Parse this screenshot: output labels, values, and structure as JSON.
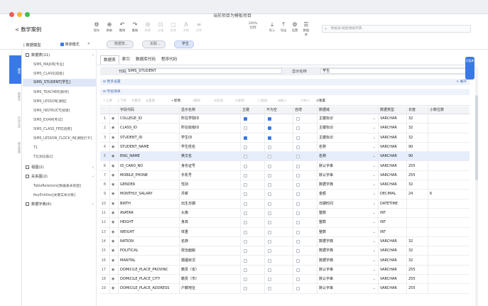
{
  "window": {
    "title": "当前项目为模板项目"
  },
  "app": {
    "title": "数学案例",
    "back": "<"
  },
  "toolbar": {
    "left": [
      {
        "icon": "⚙",
        "label": "保存"
      },
      {
        "icon": "⊕",
        "label": "刷新"
      },
      {
        "icon": "↶",
        "label": "撤销"
      },
      {
        "icon": "↷",
        "label": "重做"
      },
      {
        "icon": "⊞",
        "label": "新建",
        "disabled": true
      },
      {
        "icon": "⊡",
        "label": "分组",
        "disabled": true
      },
      {
        "icon": "▢",
        "label": "形状",
        "disabled": true
      },
      {
        "icon": "A",
        "label": "字体",
        "disabled": true
      },
      {
        "icon": "≡",
        "label": "对齐",
        "disabled": true
      }
    ],
    "zoom": {
      "label": "100%",
      "caption": "比例"
    },
    "right": [
      {
        "icon": "⤓",
        "label": "导入"
      },
      {
        "icon": "⤒",
        "label": "导出"
      },
      {
        "icon": "⚙",
        "label": "设置"
      },
      {
        "icon": "☰",
        "label": "数据库"
      }
    ]
  },
  "search": {
    "placeholder": "数据表/视图/数据字典"
  },
  "model": {
    "label": "| 数据模型",
    "mode": "简单模式",
    "collapse": "«"
  },
  "doctabs": [
    {
      "label": "数据表...",
      "active": false
    },
    {
      "label": "关联...",
      "active": false
    },
    {
      "label": "学生",
      "active": true
    }
  ],
  "sidebar_icons": [
    {
      "label": "模型",
      "active": true
    },
    {
      "label": "数据库",
      "active": false
    },
    {
      "label": "代码生成",
      "active": false
    },
    {
      "label": "版本管理",
      "active": false
    }
  ],
  "tree": {
    "groups": [
      {
        "label": "数据表(11)"
      },
      {
        "label": "视图(2)"
      },
      {
        "label": "关系图(2)"
      },
      {
        "label": "数据字典(6)"
      }
    ],
    "tables": [
      "SIMS_MAJOR[专业]",
      "SIMS_CLASS[班级]",
      "SIMS_STUDENT[学生]",
      "SIMS_TEACHER[教师]",
      "SIMS_LESSON[课程]",
      "SIMS_INSTRUCT[授课]",
      "SIMS_EXAM[考试]",
      "SIMS_CLASS_FEE[班费]",
      "SIMS_LESSON_CLOCK_IN[课程打卡]",
      "T1",
      "T2[测试表2]"
    ],
    "diagrams": [
      "TableRelations[数据表关系图]",
      "KeyEntities[关键实体对象]"
    ]
  },
  "tabs": [
    "数据表",
    "索引",
    "数据库代码",
    "程序代码"
  ],
  "form": {
    "code_label": "代码",
    "code_value": "SIMS_STUDENT",
    "name_label": "显示名称",
    "name_value": "学生"
  },
  "section_more": {
    "label": "⊟ 更多设置",
    "toggle": "∨ 展开"
  },
  "section_fields": {
    "label": "⊟ 字段清单"
  },
  "subtoolbar": [
    "↑上移",
    "↓下移",
    "⇈置顶",
    "⇊置底",
    "+新增",
    "−删除",
    "⊕追加",
    "⊡复制",
    "□粘贴",
    "⊞插入",
    "☷导入",
    "↺重置"
  ],
  "columns": [
    "",
    "",
    "字段代码",
    "显示名称",
    "主键",
    "不为空",
    "自增",
    "数据域",
    "数据类型",
    "长度",
    "小数位数"
  ],
  "rows": [
    {
      "no": "1",
      "code": "COLLEGE_ID",
      "name": "所在学院ID",
      "pk": true,
      "nn": true,
      "ai": false,
      "domain": "主键标识",
      "type": "VARCHAR",
      "len": "32",
      "dec": ""
    },
    {
      "no": "2",
      "code": "CLASS_ID",
      "name": "所在班级ID",
      "pk": false,
      "nn": true,
      "ai": false,
      "domain": "主键标识",
      "type": "VARCHAR",
      "len": "32",
      "dec": ""
    },
    {
      "no": "3",
      "code": "STUDENT_ID",
      "name": "学生ID",
      "pk": true,
      "nn": true,
      "ai": false,
      "domain": "主键标识",
      "type": "VARCHAR",
      "len": "32",
      "dec": ""
    },
    {
      "no": "4",
      "code": "STUDENT_NAME",
      "name": "学生姓名",
      "pk": false,
      "nn": false,
      "ai": false,
      "domain": "名称",
      "type": "VARCHAR",
      "len": "90",
      "dec": ""
    },
    {
      "no": "5",
      "code": "ENG_NAME",
      "name": "英文名",
      "pk": false,
      "nn": false,
      "ai": false,
      "domain": "名称",
      "type": "VARCHAR",
      "len": "90",
      "dec": "",
      "hl": true
    },
    {
      "no": "6",
      "code": "ID_CARD_NO",
      "name": "身份证号",
      "pk": false,
      "nn": false,
      "ai": false,
      "domain": "默认字串",
      "type": "VARCHAR",
      "len": "255",
      "dec": ""
    },
    {
      "no": "7",
      "code": "MOBILE_PHONE",
      "name": "手机号",
      "pk": false,
      "nn": false,
      "ai": false,
      "domain": "默认字串",
      "type": "VARCHAR",
      "len": "255",
      "dec": ""
    },
    {
      "no": "8",
      "code": "GENDER",
      "name": "性别",
      "pk": false,
      "nn": false,
      "ai": false,
      "domain": "数据字典",
      "type": "VARCHAR",
      "len": "32",
      "dec": ""
    },
    {
      "no": "9",
      "code": "MONTHLY_SALARY",
      "name": "月薪",
      "pk": false,
      "nn": false,
      "ai": false,
      "domain": "金额",
      "type": "DECIMAL",
      "len": "24",
      "dec": "6"
    },
    {
      "no": "10",
      "code": "BIRTH",
      "name": "出生日期",
      "pk": false,
      "nn": false,
      "ai": false,
      "domain": "日期时间",
      "type": "DATETIME",
      "len": "",
      "dec": ""
    },
    {
      "no": "11",
      "code": "AVATAR",
      "name": "头像",
      "pk": false,
      "nn": false,
      "ai": false,
      "domain": "整数",
      "type": "INT",
      "len": "",
      "dec": ""
    },
    {
      "no": "12",
      "code": "HEIGHT",
      "name": "身高",
      "pk": false,
      "nn": false,
      "ai": false,
      "domain": "整数",
      "type": "INT",
      "len": "",
      "dec": ""
    },
    {
      "no": "13",
      "code": "WEIGHT",
      "name": "体重",
      "pk": false,
      "nn": false,
      "ai": false,
      "domain": "整数",
      "type": "INT",
      "len": "",
      "dec": ""
    },
    {
      "no": "14",
      "code": "NATION",
      "name": "名族",
      "pk": false,
      "nn": false,
      "ai": false,
      "domain": "数据字典",
      "type": "VARCHAR",
      "len": "32",
      "dec": ""
    },
    {
      "no": "15",
      "code": "POLITICAL",
      "name": "政治面貌",
      "pk": false,
      "nn": false,
      "ai": false,
      "domain": "数据字典",
      "type": "VARCHAR",
      "len": "32",
      "dec": ""
    },
    {
      "no": "16",
      "code": "MARITAL",
      "name": "婚姻状况",
      "pk": false,
      "nn": false,
      "ai": false,
      "domain": "数据字典",
      "type": "VARCHAR",
      "len": "32",
      "dec": ""
    },
    {
      "no": "17",
      "code": "DOMICILE_PLACE_PROVINC",
      "name": "籍贯（省）",
      "pk": false,
      "nn": false,
      "ai": false,
      "domain": "默认字串",
      "type": "VARCHAR",
      "len": "255",
      "dec": ""
    },
    {
      "no": "18",
      "code": "DOMICILE_PLACE_CITY",
      "name": "籍贯（市）",
      "pk": false,
      "nn": false,
      "ai": false,
      "domain": "默认字串",
      "type": "VARCHAR",
      "len": "255",
      "dec": ""
    },
    {
      "no": "19",
      "code": "DOMICILE_PLACE_ADDRESS",
      "name": "户籍地址",
      "pk": false,
      "nn": false,
      "ai": false,
      "domain": "默认字串",
      "type": "VARCHAR",
      "len": "255",
      "dec": ""
    }
  ],
  "right_panel": {
    "label": "字段库"
  }
}
